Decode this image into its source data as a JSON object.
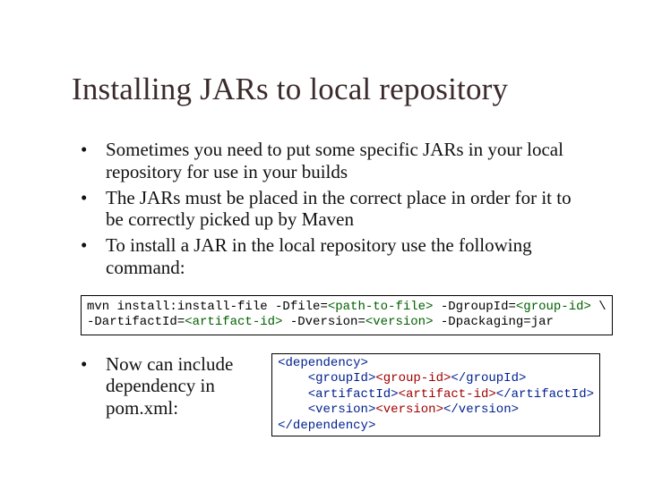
{
  "title": "Installing JARs to local repository",
  "bullets": [
    "Sometimes you need to put some specific JARs in your local repository for use in your builds",
    "The JARs must be placed in the correct place in order for it to be correctly picked up by Maven",
    "To install a JAR in the local repository use the following command:"
  ],
  "cmd": {
    "p1": "mvn install:install-file -Dfile=",
    "path": "<path-to-file>",
    "p2": " -DgroupId=",
    "gid": "<group-id>",
    "p3": " \\",
    "p4": "-DartifactId=",
    "aid": "<artifact-id>",
    "p5": " -Dversion=",
    "ver": "<version>",
    "p6": " -Dpackaging=jar"
  },
  "bullet4": "Now can include dependency in pom.xml:",
  "xml": {
    "l1a": "<dependency>",
    "l2a": "<groupId>",
    "l2b": "<group-id>",
    "l2c": "</groupId>",
    "l3a": "<artifactId>",
    "l3b": "<artifact-id>",
    "l3c": "</artifactId>",
    "l4a": "<version>",
    "l4b": "<version>",
    "l4c": "</version>",
    "l5a": "</dependency>"
  }
}
